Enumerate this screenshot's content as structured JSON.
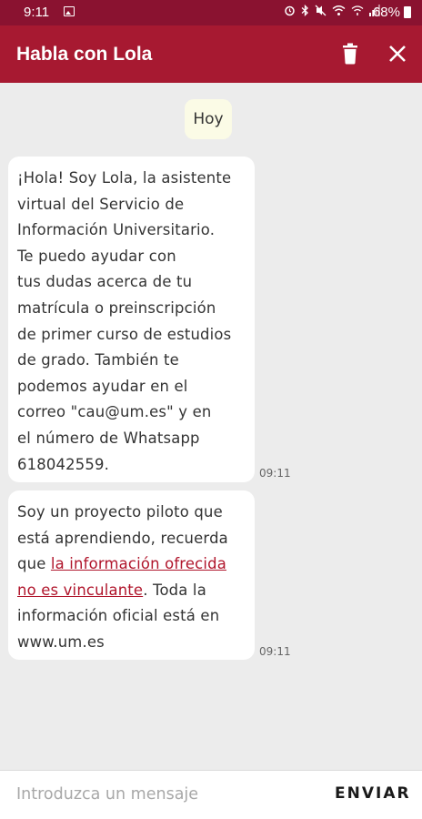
{
  "status_bar": {
    "time": "9:11",
    "battery_percent": "68%",
    "icons": [
      "image-icon",
      "alarm-icon",
      "bluetooth-icon",
      "mute-icon",
      "wifi-icon",
      "hotspot-icon",
      "signal-icon",
      "battery-icon"
    ]
  },
  "app_bar": {
    "title": "Habla con Lola",
    "icons": [
      "trash-icon",
      "close-icon"
    ]
  },
  "chat": {
    "date_label": "Hoy",
    "messages": [
      {
        "lines": [
          "¡Hola! Soy Lola, la asistente",
          "virtual del Servicio de",
          "Información Universitario.",
          "Te puedo ayudar con",
          "tus dudas acerca de tu",
          "matrícula o preinscripción",
          "de primer curso de estudios",
          "de grado. También te",
          "podemos ayudar en el",
          "correo \"cau@um.es\" y en",
          "el número de Whatsapp",
          "618042559."
        ],
        "time": "09:11"
      },
      {
        "line1": "Soy un proyecto piloto que",
        "line2": "está aprendiendo, recuerda",
        "line3_prefix": "que ",
        "line3_link": "la información ofrecida",
        "line4_link": "no es vinculante",
        "line4_suffix": ". Toda la",
        "line5": "información oficial está en",
        "line6": "www.um.es",
        "time": "09:11"
      }
    ]
  },
  "input": {
    "placeholder": "Introduzca un mensaje",
    "value": "",
    "send_label": "ENVIAR"
  },
  "colors": {
    "status_bar": "#8a1230",
    "app_bar": "#a71931",
    "chat_background": "#ececec",
    "date_chip": "#fbfbe6",
    "link": "#b0152b"
  }
}
